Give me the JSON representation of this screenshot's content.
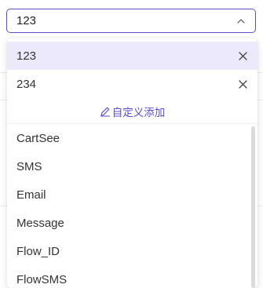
{
  "select": {
    "value": "123"
  },
  "selected_options": [
    {
      "label": "123"
    },
    {
      "label": "234"
    }
  ],
  "custom_add_label": "自定义添加",
  "options": [
    {
      "label": "CartSee"
    },
    {
      "label": "SMS"
    },
    {
      "label": "Email"
    },
    {
      "label": "Message"
    },
    {
      "label": "Flow_ID"
    },
    {
      "label": "FlowSMS"
    }
  ],
  "colors": {
    "accent": "#5a4fc8",
    "selected_bg": "#ebe9fb"
  },
  "icons": {
    "dropdown": "chevron-up-icon",
    "remove": "close-icon",
    "add": "edit-pencil-icon"
  }
}
